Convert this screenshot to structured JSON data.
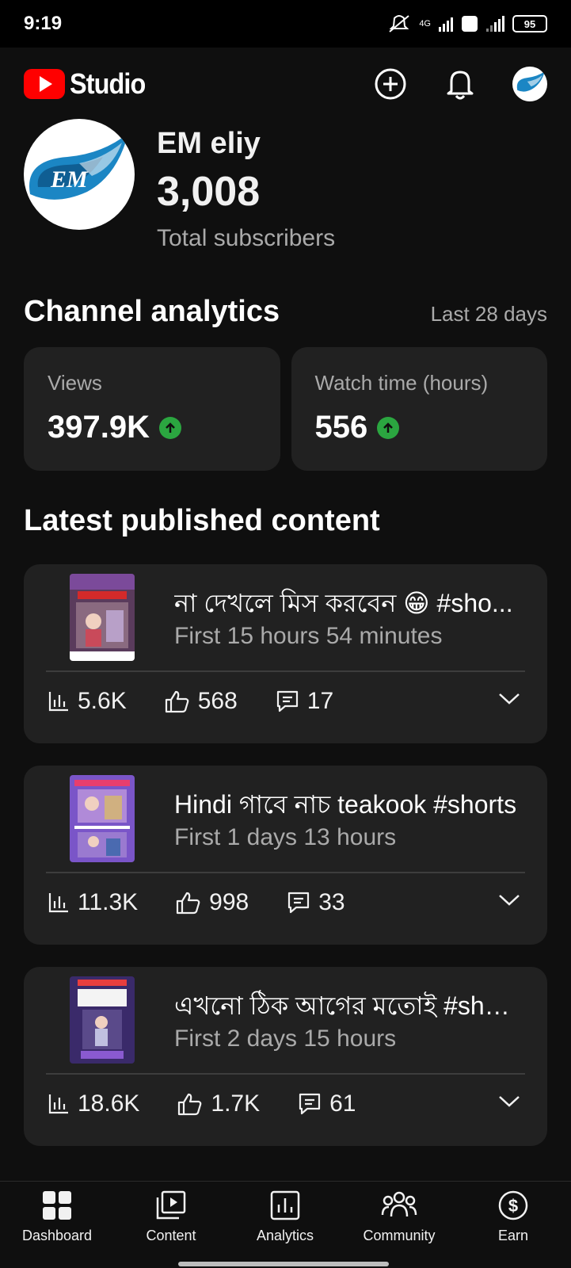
{
  "status_bar": {
    "time": "9:19",
    "network": "4G",
    "battery": "95"
  },
  "app": {
    "brand": "Studio"
  },
  "channel": {
    "name": "EM eliy",
    "subscribers": "3,008",
    "subscribers_label": "Total subscribers",
    "avatar_text": "EM"
  },
  "analytics": {
    "heading": "Channel analytics",
    "range": "Last 28 days",
    "cards": [
      {
        "label": "Views",
        "value": "397.9K",
        "trend": "up"
      },
      {
        "label": "Watch time (hours)",
        "value": "556",
        "trend": "up"
      }
    ]
  },
  "latest": {
    "heading": "Latest published content",
    "items": [
      {
        "title": "না দেখলে মিস করবেন 😁 #sho...",
        "sub": "First 15 hours 54 minutes",
        "views": "5.6K",
        "likes": "568",
        "comments": "17"
      },
      {
        "title": "Hindi গাবে নাচ teakook #shorts",
        "sub": "First 1 days 13 hours",
        "views": "11.3K",
        "likes": "998",
        "comments": "33"
      },
      {
        "title": "এখনো ঠিক আগের মতোই #shor...",
        "sub": "First 2 days 15 hours",
        "views": "18.6K",
        "likes": "1.7K",
        "comments": "61"
      }
    ]
  },
  "nav": {
    "items": [
      {
        "label": "Dashboard",
        "icon": "dashboard-icon"
      },
      {
        "label": "Content",
        "icon": "content-icon"
      },
      {
        "label": "Analytics",
        "icon": "analytics-icon"
      },
      {
        "label": "Community",
        "icon": "community-icon"
      },
      {
        "label": "Earn",
        "icon": "earn-icon"
      }
    ]
  },
  "colors": {
    "brand_red": "#ff0000",
    "trend_green": "#2ba640",
    "card_bg": "#212121"
  }
}
